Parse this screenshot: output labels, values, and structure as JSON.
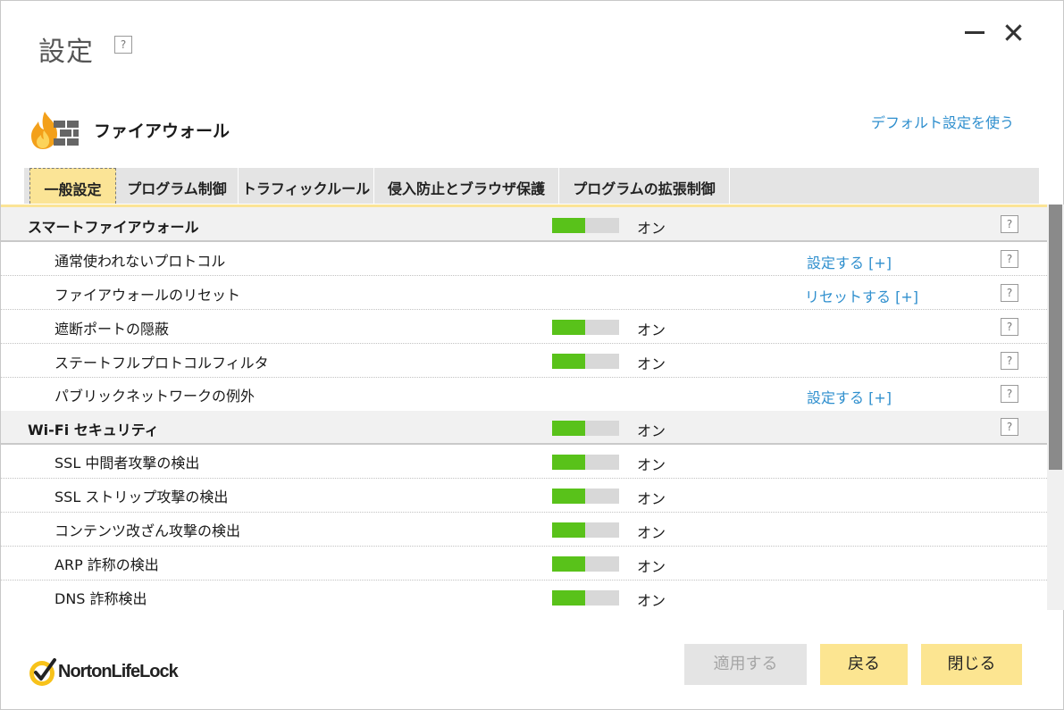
{
  "window": {
    "title": "設定",
    "help": "?"
  },
  "header": {
    "section_title": "ファイアウォール",
    "default_link": "デフォルト設定を使う"
  },
  "tabs": [
    {
      "label": "一般設定"
    },
    {
      "label": "プログラム制御"
    },
    {
      "label": "トラフィックルール"
    },
    {
      "label": "侵入防止とブラウザ保護"
    },
    {
      "label": "プログラムの拡張制御"
    }
  ],
  "rows": [
    {
      "label": "スマートファイアウォール",
      "state": "オン",
      "help": "?"
    },
    {
      "label": "通常使われないプロトコル",
      "action": "設定する [+]",
      "help": "?"
    },
    {
      "label": "ファイアウォールのリセット",
      "action": "リセットする [+]",
      "help": "?"
    },
    {
      "label": "遮断ポートの隠蔽",
      "state": "オン",
      "help": "?"
    },
    {
      "label": "ステートフルプロトコルフィルタ",
      "state": "オン",
      "help": "?"
    },
    {
      "label": "パブリックネットワークの例外",
      "action": "設定する [+]",
      "help": "?"
    },
    {
      "label": "Wi-Fi セキュリティ",
      "state": "オン",
      "help": "?"
    },
    {
      "label": "SSL 中間者攻撃の検出",
      "state": "オン"
    },
    {
      "label": "SSL ストリップ攻撃の検出",
      "state": "オン"
    },
    {
      "label": "コンテンツ改ざん攻撃の検出",
      "state": "オン"
    },
    {
      "label": "ARP 詐称の検出",
      "state": "オン"
    },
    {
      "label": "DNS 詐称検出",
      "state": "オン"
    }
  ],
  "footer": {
    "brand": "NortonLifeLock",
    "apply_label": "適用する",
    "back_label": "戻る",
    "close_label": "閉じる"
  },
  "colors": {
    "accent_yellow": "#fce591",
    "toggle_on": "#59c21a",
    "link_blue": "#2f8fce"
  }
}
